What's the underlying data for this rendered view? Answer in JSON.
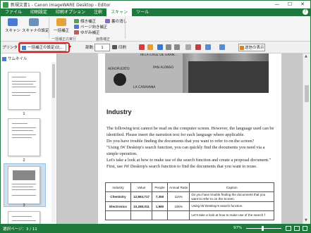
{
  "window": {
    "title": "新規文書1 - Canon imageWARE Desktop - Editor",
    "min": "—",
    "max": "☐",
    "close": "✕"
  },
  "menu": {
    "tabs": [
      "ファイル",
      "印刷設定",
      "印刷オプション",
      "注釈",
      "スキャン",
      "ツール"
    ],
    "active": "スキャン",
    "help": "?"
  },
  "ribbon": {
    "scan": "スキャン",
    "scan_settings": "スキャナの設定",
    "batch_correct": "一括補正",
    "tilt_correct": "傾き補正",
    "page_orientation": "ページ向き補正",
    "warp_correct": "ゆがみ補正",
    "erase_edges": "裏の消し",
    "group_label": "画像補正",
    "group_label2": "一括補正の実行"
  },
  "toolbar": {
    "printer_label": "プリンタ",
    "printer_value": "一括補正の設定(比...",
    "copies_label": "部数:",
    "copies_value": "1",
    "print_mode": "印刷",
    "zoom_btn": "送信の表示"
  },
  "sidebar": {
    "title": "サムネイル",
    "pages": [
      "1",
      "2",
      "3"
    ]
  },
  "document": {
    "heading": "Industry",
    "map_labels": [
      "IN LA CRUZ DE GRAN...",
      "AEROPUERTO",
      "PAN ALONSO",
      "LA CARAVANA"
    ],
    "paragraphs": [
      "The following text cannot be read on the computer screen. However, the language used can be identified. Please insert the narration text for each language where applicable.",
      "Do you have trouble finding the documents that you want to refer to on the screen?",
      "\"Using iW Desktop's search function, you can quickly find the documents you need via a simple operation.",
      "Let's take a look at how to make use of the search function and create a proposal document.\"",
      "First, use iW Desktop's search function to find the documents that you want to reuse."
    ],
    "table": {
      "headers": [
        "Industry",
        "Value",
        "People",
        "Annual Ratio",
        "Caption"
      ],
      "rows": [
        [
          "Chemistry",
          "12,863,717",
          "7,350",
          "116%",
          "Do you have trouble finding the documents that you want to refer to on the Screen."
        ],
        [
          "Electronics",
          "10,280,011",
          "1,980",
          "105%",
          "Using iW Desktop's search function."
        ],
        [
          "",
          "",
          "",
          "",
          "Let's take a look at how to make use of the search f"
        ]
      ]
    }
  },
  "status": {
    "pages": "選択ページ：3 / 11",
    "zoom": "97%"
  },
  "colors": {
    "accent": "#1e7a3c",
    "highlight": "#e02020"
  }
}
